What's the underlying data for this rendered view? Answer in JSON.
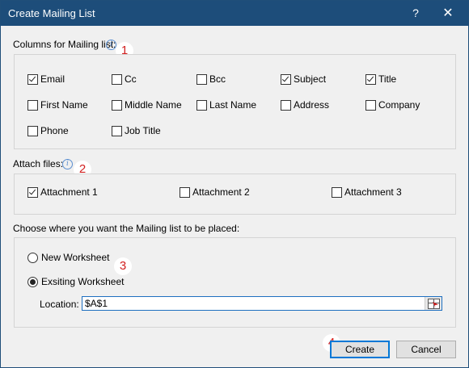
{
  "window": {
    "title": "Create Mailing List",
    "help_label": "?",
    "close_label": "✕"
  },
  "columns_section": {
    "label": "Columns for Mailing list:",
    "badge": "1",
    "items": [
      {
        "label": "Email",
        "checked": true
      },
      {
        "label": "Cc",
        "checked": false
      },
      {
        "label": "Bcc",
        "checked": false
      },
      {
        "label": "Subject",
        "checked": true
      },
      {
        "label": "Title",
        "checked": true
      },
      {
        "label": "First Name",
        "checked": false
      },
      {
        "label": "Middle Name",
        "checked": false
      },
      {
        "label": "Last Name",
        "checked": false
      },
      {
        "label": "Address",
        "checked": false
      },
      {
        "label": "Company",
        "checked": false
      },
      {
        "label": "Phone",
        "checked": false
      },
      {
        "label": "Job Title",
        "checked": false
      }
    ]
  },
  "attach_section": {
    "label": "Attach files:",
    "badge": "2",
    "items": [
      {
        "label": "Attachment 1",
        "checked": true
      },
      {
        "label": "Attachment 2",
        "checked": false
      },
      {
        "label": "Attachment 3",
        "checked": false
      }
    ]
  },
  "placement_section": {
    "label": "Choose where you want the Mailing list to be placed:",
    "badge": "3",
    "options": [
      {
        "label": "New Worksheet",
        "selected": false
      },
      {
        "label": "Exsiting Worksheet",
        "selected": true
      }
    ],
    "location_label": "Location:",
    "location_value": "$A$1"
  },
  "footer": {
    "badge": "4",
    "create_label": "Create",
    "cancel_label": "Cancel"
  },
  "icons": {
    "info": "info-icon",
    "range_select": "range-select-icon"
  },
  "colors": {
    "titlebar": "#1d4d7a",
    "badge_text": "#d22020",
    "focus": "#0078d7"
  }
}
